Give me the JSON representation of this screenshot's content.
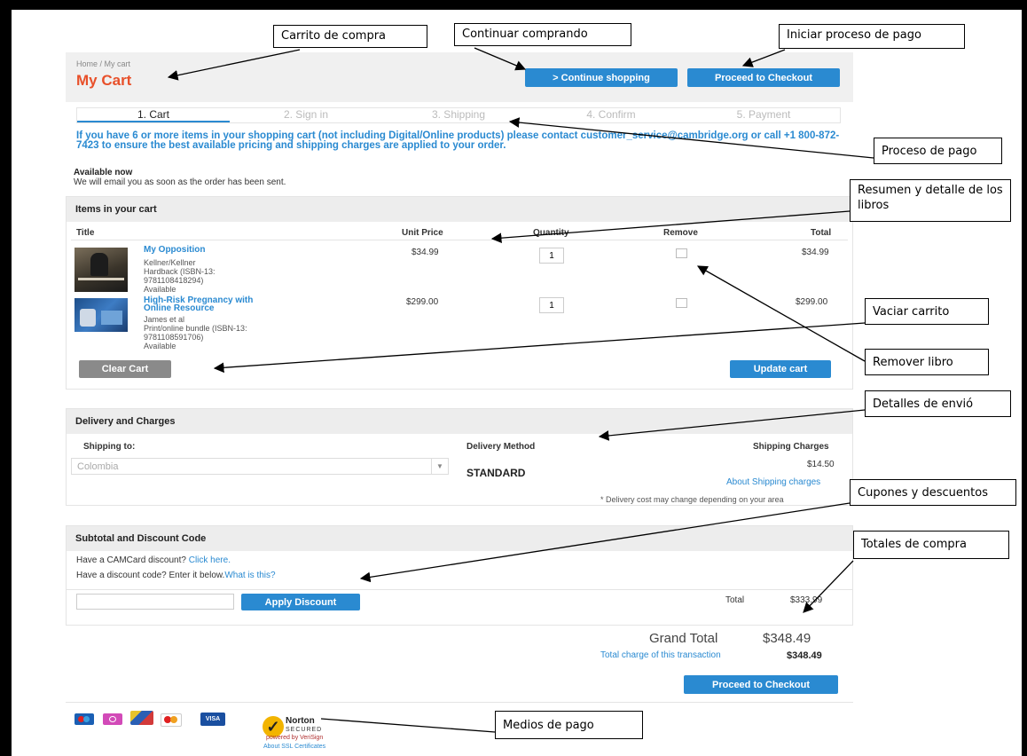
{
  "header": {
    "breadcrumb": "Home  /  My cart",
    "title": "My Cart",
    "continue_label": "> Continue shopping",
    "checkout_label": "Proceed to Checkout"
  },
  "steps": [
    "1. Cart",
    "2. Sign in",
    "3. Shipping",
    "4. Confirm",
    "5. Payment"
  ],
  "notice": "If you have 6 or more items in your shopping cart (not including Digital/Online products) please contact customer_service@cambridge.org or call +1 800-872-7423 to ensure the best available pricing and shipping charges are applied to your order.",
  "availability": {
    "title": "Available now",
    "text": "We will email you as soon as the order has been sent."
  },
  "cart": {
    "heading": "Items in your cart",
    "columns": [
      "Title",
      "Unit Price",
      "Quantity",
      "Remove",
      "Total"
    ],
    "items": [
      {
        "title": "My Opposition",
        "details": [
          "Kellner/Kellner",
          "Hardback (ISBN-13:",
          "9781108418294)",
          "Available"
        ],
        "unit_price": "$34.99",
        "qty": "1",
        "total": "$34.99"
      },
      {
        "title": "High-Risk Pregnancy with Online Resource",
        "details": [
          "James et al",
          "Print/online bundle (ISBN-13:",
          "9781108591706)",
          "Available"
        ],
        "unit_price": "$299.00",
        "qty": "1",
        "total": "$299.00"
      }
    ],
    "clear_label": "Clear Cart",
    "update_label": "Update cart"
  },
  "delivery": {
    "heading": "Delivery and Charges",
    "ship_to_label": "Shipping to:",
    "method_label": "Delivery Method",
    "charges_label": "Shipping Charges",
    "country": "Colombia",
    "method": "STANDARD",
    "charge": "$14.50",
    "about_link": "About Shipping charges",
    "note": "* Delivery cost may change depending on your area"
  },
  "discount": {
    "heading": "Subtotal and Discount Code",
    "camcard_text": "Have a CAMCard discount?",
    "camcard_link": "Click here.",
    "code_text": "Have a discount code? Enter it below.",
    "code_link": "What is this?",
    "apply_label": "Apply Discount",
    "total_label": "Total",
    "total_value": "$333.99"
  },
  "totals": {
    "grand_label": "Grand Total",
    "grand_value": "$348.49",
    "charge_label": "Total charge of this transaction",
    "charge_value": "$348.49",
    "checkout_label": "Proceed to Checkout"
  },
  "footer": {
    "norton_label": "Norton",
    "norton_secured": "SECURED",
    "powered": "powered by VeriSign",
    "ssl_link": "About SSL Certificates"
  },
  "callouts": {
    "carrito": "Carrito de compra",
    "continuar": "Continuar comprando",
    "iniciar": "Iniciar proceso de pago",
    "proceso": "Proceso de pago",
    "resumen": "Resumen y detalle de los libros",
    "vaciar": "Vaciar carrito",
    "remover": "Remover libro",
    "envio": "Detalles de envió",
    "cupones": "Cupones y descuentos",
    "totales": "Totales de compra",
    "medios": "Medios de pago"
  },
  "colors": {
    "accent": "#2a8ad1",
    "title": "#e8502a",
    "panel": "#ededed",
    "button_gray": "#8a8a8a"
  }
}
